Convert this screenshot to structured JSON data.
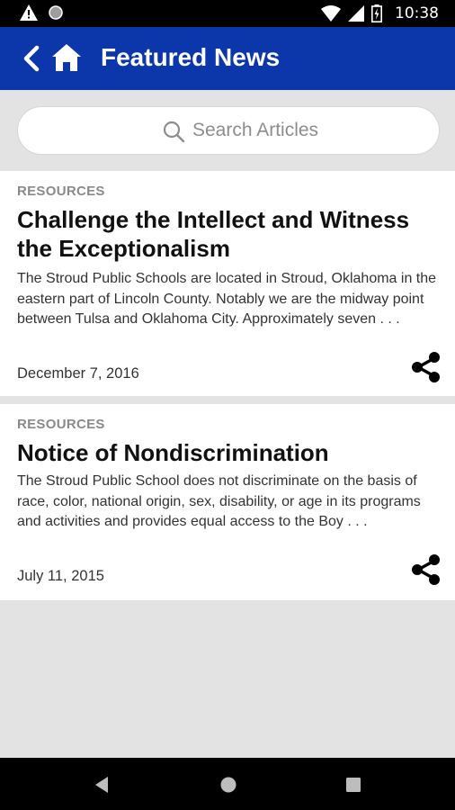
{
  "status_bar": {
    "time": "10:38",
    "icons": [
      "warning-icon",
      "circle-icon",
      "wifi-icon",
      "signal-icon",
      "battery-icon"
    ]
  },
  "app_bar": {
    "title": "Featured News",
    "icons": [
      "back-arrow-icon",
      "home-icon"
    ],
    "background": "#0b37ab"
  },
  "search": {
    "placeholder": "Search Articles",
    "value": ""
  },
  "articles": [
    {
      "category": "RESOURCES",
      "title": "Challenge the Intellect and Witness the Exceptionalism",
      "excerpt": "The Stroud Public Schools are located in Stroud, Oklahoma in the eastern part of Lincoln County. Notably we are the midway point between Tulsa and Oklahoma City. Approximately seven . . .",
      "date": "December 7, 2016"
    },
    {
      "category": "RESOURCES",
      "title": "Notice of Nondiscrimination",
      "excerpt": "The Stroud Public School does not discriminate on the basis of race, color, national origin, sex, disability, or age in its programs and activities and provides equal access to the Boy . . .",
      "date": "July 11, 2015"
    }
  ],
  "nav_bar": {
    "icons": [
      "nav-back-icon",
      "nav-home-icon",
      "nav-recents-icon"
    ]
  }
}
